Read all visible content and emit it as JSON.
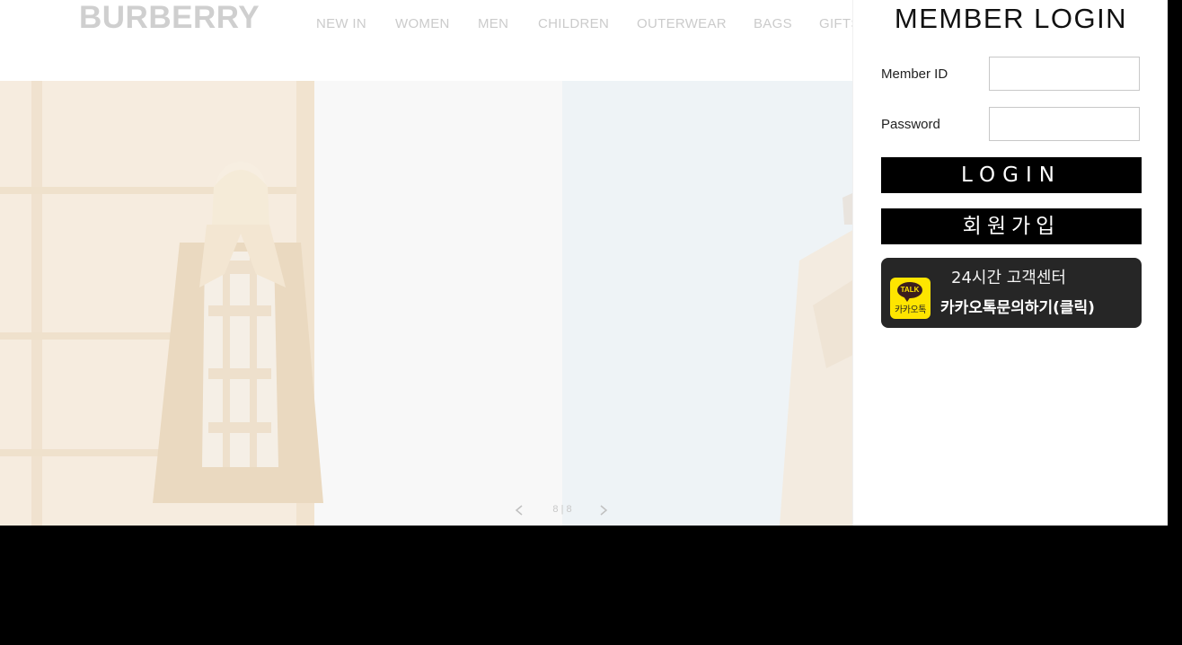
{
  "brand": {
    "logo": "BURBERRY"
  },
  "nav": {
    "items": [
      {
        "label": "NEW IN"
      },
      {
        "label": "WOMEN"
      },
      {
        "label": "MEN"
      },
      {
        "label": "CHILDREN"
      },
      {
        "label": "OUTERWEAR"
      },
      {
        "label": "BAGS"
      },
      {
        "label": "GIFTS"
      }
    ]
  },
  "slider": {
    "counter": "8 | 8"
  },
  "login": {
    "title": "MEMBER LOGIN",
    "member_id_label": "Member ID",
    "member_id_value": "",
    "password_label": "Password",
    "password_value": "",
    "login_button": "LOGIN",
    "join_button": "회원가입"
  },
  "kakao": {
    "headline": "24시간 고객센터",
    "cta": "카카오톡문의하기(클릭)",
    "icon_bubble": "TALK",
    "icon_text": "카카오톡"
  },
  "colors": {
    "button_bg": "#000000",
    "kakao_yellow": "#fee500",
    "kakao_panel": "#262626"
  }
}
